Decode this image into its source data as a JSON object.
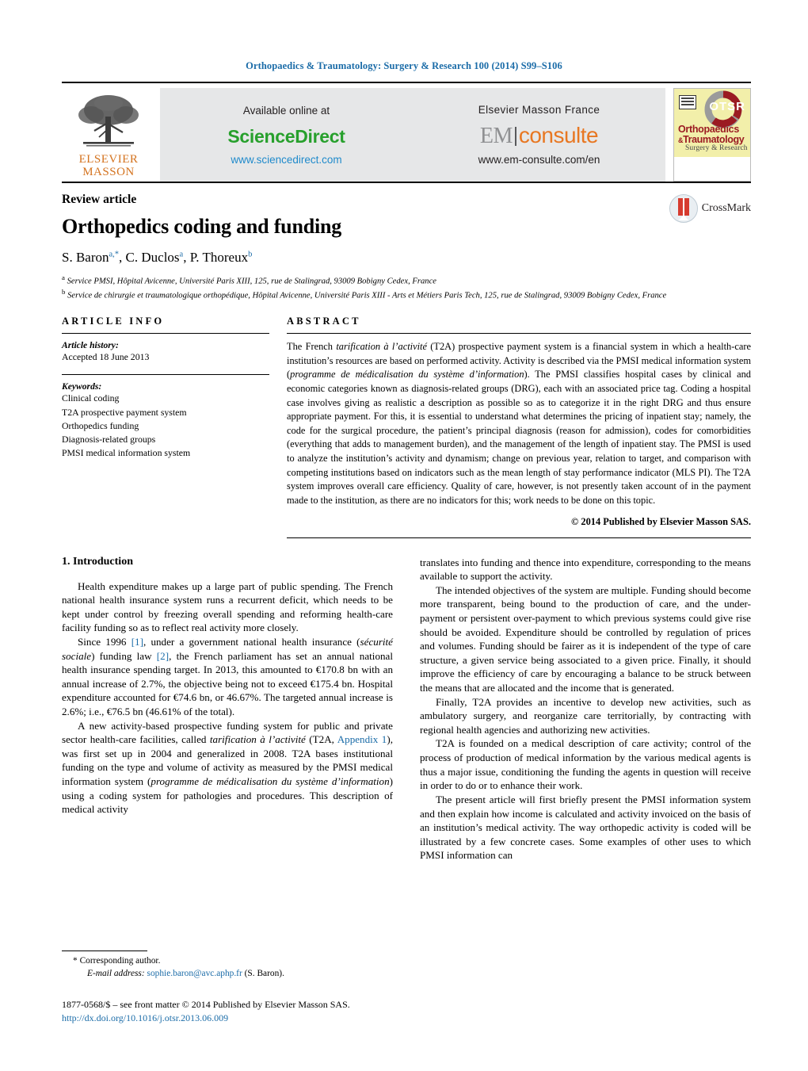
{
  "running_head": "Orthopaedics & Traumatology: Surgery & Research 100 (2014) S99–S106",
  "masthead": {
    "elsevier_line1": "ELSEVIER",
    "elsevier_line2": "MASSON",
    "available_online": "Available online at",
    "sciencedirect": "ScienceDirect",
    "sciencedirect_url": "www.sciencedirect.com",
    "elsevier_masson_france": "Elsevier Masson France",
    "em_prefix": "EM",
    "em_suffix": "consulte",
    "em_url": "www.em-consulte.com/en",
    "cover": {
      "acronym": "OTSR",
      "title_line1": "Orthopaedics",
      "title_amp": "&",
      "title_line2": "Traumatology",
      "subtitle": "Surgery & Research"
    }
  },
  "article": {
    "kind": "Review article",
    "title": "Orthopedics coding and funding",
    "authors": "S. Baron",
    "authors_full": [
      {
        "name": "S. Baron",
        "marks": "a,*"
      },
      {
        "name": "C. Duclos",
        "marks": "a"
      },
      {
        "name": "P. Thoreux",
        "marks": "b"
      }
    ],
    "affiliations": [
      {
        "mark": "a",
        "text": "Service PMSI, Hôpital Avicenne, Université Paris XIII, 125, rue de Stalingrad, 93009 Bobigny Cedex, France"
      },
      {
        "mark": "b",
        "text": "Service de chirurgie et traumatologique orthopédique, Hôpital Avicenne, Université Paris XIII - Arts et Métiers Paris Tech, 125, rue de Stalingrad, 93009 Bobigny Cedex, France"
      }
    ],
    "crossmark_label": "CrossMark"
  },
  "info": {
    "heading": "ARTICLE INFO",
    "history_label": "Article history:",
    "history_value": "Accepted 18 June 2013",
    "keywords_label": "Keywords:",
    "keywords": [
      "Clinical coding",
      "T2A prospective payment system",
      "Orthopedics funding",
      "Diagnosis-related groups",
      "PMSI medical information system"
    ]
  },
  "abstract": {
    "heading": "ABSTRACT",
    "paragraph_parts": [
      {
        "t": "The French ",
        "i": false
      },
      {
        "t": "tarification à l’activité",
        "i": true
      },
      {
        "t": " (T2A) prospective payment system is a financial system in which a health-care institution’s resources are based on performed activity. Activity is described via the PMSI medical information system (",
        "i": false
      },
      {
        "t": "programme de médicalisation du système d’information",
        "i": true
      },
      {
        "t": "). The PMSI classifies hospital cases by clinical and economic categories known as diagnosis-related groups (DRG), each with an associated price tag. Coding a hospital case involves giving as realistic a description as possible so as to categorize it in the right DRG and thus ensure appropriate payment. For this, it is essential to understand what determines the pricing of inpatient stay; namely, the code for the surgical procedure, the patient’s principal diagnosis (reason for admission), codes for comorbidities (everything that adds to management burden), and the management of the length of inpatient stay. The PMSI is used to analyze the institution’s activity and dynamism; change on previous year, relation to target, and comparison with competing institutions based on indicators such as the mean length of stay performance indicator (MLS PI). The T2A system improves overall care efficiency. Quality of care, however, is not presently taken account of in the payment made to the institution, as there are no indicators for this; work needs to be done on this topic.",
        "i": false
      }
    ],
    "copyright": "© 2014 Published by Elsevier Masson SAS."
  },
  "body": {
    "section_heading": "1.  Introduction",
    "left_paragraphs": [
      [
        {
          "t": "Health expenditure makes up a large part of public spending. The French national health insurance system runs a recurrent deficit, which needs to be kept under control by freezing overall spending and reforming health-care facility funding so as to reflect real activity more closely.",
          "s": "plain"
        }
      ],
      [
        {
          "t": "Since 1996 ",
          "s": "plain"
        },
        {
          "t": "[1]",
          "s": "ref"
        },
        {
          "t": ", under a government national health insurance (",
          "s": "plain"
        },
        {
          "t": "sécurité sociale",
          "s": "italic"
        },
        {
          "t": ") funding law ",
          "s": "plain"
        },
        {
          "t": "[2]",
          "s": "ref"
        },
        {
          "t": ", the French parliament has set an annual national health insurance spending target. In 2013, this amounted to €170.8 bn with an annual increase of 2.7%, the objective being not to exceed €175.4 bn. Hospital expenditure accounted for €74.6 bn, or 46.67%. The targeted annual increase is 2.6%; i.e., €76.5 bn (46.61% of the total).",
          "s": "plain"
        }
      ],
      [
        {
          "t": "A new activity-based prospective funding system for public and private sector health-care facilities, called ",
          "s": "plain"
        },
        {
          "t": "tarification à l’activité",
          "s": "italic"
        },
        {
          "t": " (T2A, ",
          "s": "plain"
        },
        {
          "t": "Appendix 1",
          "s": "ref"
        },
        {
          "t": "), was first set up in 2004 and generalized in 2008. T2A bases institutional funding on the type and volume of activity as measured by the PMSI medical information system (",
          "s": "plain"
        },
        {
          "t": "programme de médicalisation du système d’information",
          "s": "italic"
        },
        {
          "t": ") using a coding system for pathologies and procedures. This description of medical activity",
          "s": "plain"
        }
      ]
    ],
    "right_paragraphs": [
      [
        {
          "t": "translates into funding and thence into expenditure, corresponding to the means available to support the activity.",
          "s": "plain"
        }
      ],
      [
        {
          "t": "The intended objectives of the system are multiple. Funding should become more transparent, being bound to the production of care, and the under-payment or persistent over-payment to which previous systems could give rise should be avoided. Expenditure should be controlled by regulation of prices and volumes. Funding should be fairer as it is independent of the type of care structure, a given service being associated to a given price. Finally, it should improve the efficiency of care by encouraging a balance to be struck between the means that are allocated and the income that is generated.",
          "s": "plain"
        }
      ],
      [
        {
          "t": "Finally, T2A provides an incentive to develop new activities, such as ambulatory surgery, and reorganize care territorially, by contracting with regional health agencies and authorizing new activities.",
          "s": "plain"
        }
      ],
      [
        {
          "t": "T2A is founded on a medical description of care activity; control of the process of production of medical information by the various medical agents is thus a major issue, conditioning the funding the agents in question will receive in order to do or to enhance their work.",
          "s": "plain"
        }
      ],
      [
        {
          "t": "The present article will first briefly present the PMSI information system and then explain how income is calculated and activity invoiced on the basis of an institution’s medical activity. The way orthopedic activity is coded will be illustrated by a few concrete cases. Some examples of other uses to which PMSI information can",
          "s": "plain"
        }
      ]
    ]
  },
  "footnotes": {
    "corresponding_marker": "*",
    "corresponding_label": "Corresponding author.",
    "email_label": "E-mail address:",
    "email": "sophie.baron@avc.aphp.fr",
    "email_suffix": "(S. Baron)."
  },
  "footer": {
    "issn_line": "1877-0568/$ – see front matter © 2014 Published by Elsevier Masson SAS.",
    "doi": "http://dx.doi.org/10.1016/j.otsr.2013.06.009"
  },
  "colors": {
    "link_blue": "#1b6ca8",
    "sciencedirect_green": "#27a02c",
    "elsevier_orange": "#d4731f",
    "em_orange": "#e87722",
    "cover_yellow": "#f2efaa",
    "cover_red": "#9b1b22"
  }
}
